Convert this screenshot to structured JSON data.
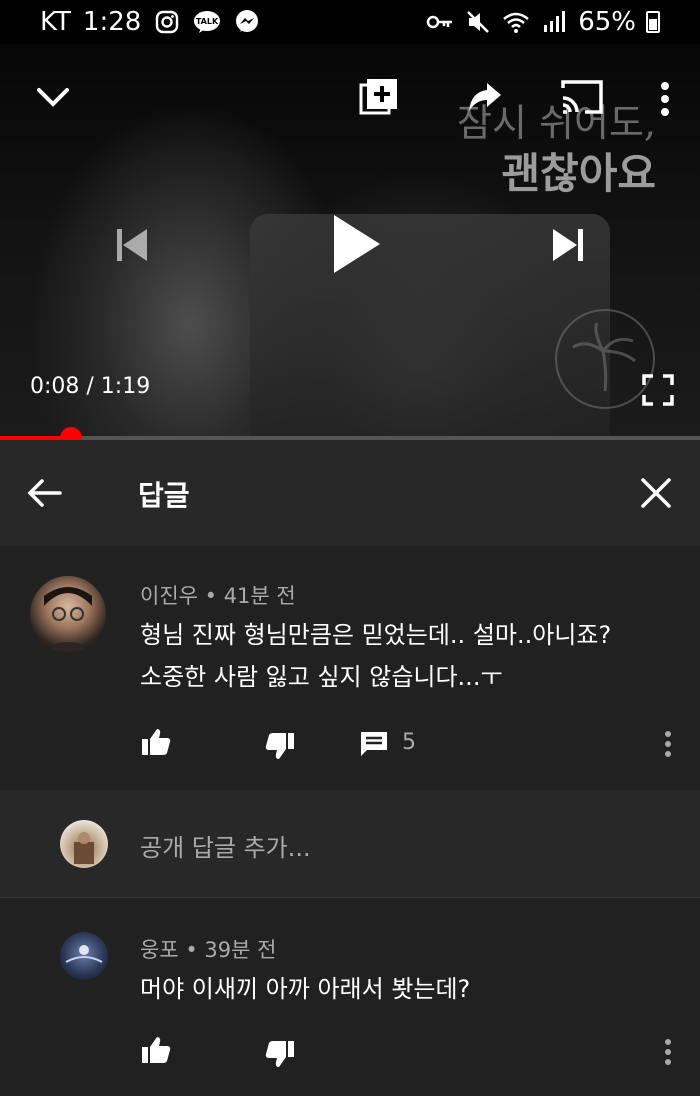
{
  "status_bar": {
    "carrier": "KT",
    "time": "1:28",
    "battery": "65%",
    "left_icons": [
      "instagram-icon",
      "kakaotalk-icon",
      "messenger-icon"
    ],
    "right_icons": [
      "key-icon",
      "mute-icon",
      "wifi-icon",
      "signal-icon",
      "battery-icon"
    ]
  },
  "video": {
    "overlay_line1": "잠시 쉬어도,",
    "overlay_line2": "괜찮아요",
    "current_time": "0:08",
    "duration": "1:19",
    "time_display": "0:08 / 1:19",
    "progress_fraction": 0.101,
    "state": "paused",
    "top_controls": [
      "collapse-icon",
      "add-to-playlist-icon",
      "share-icon",
      "cast-icon",
      "more-icon"
    ],
    "center_controls": [
      "previous-icon",
      "play-icon",
      "next-icon"
    ],
    "fullscreen_icon": "fullscreen-icon",
    "accent": "#ff0000"
  },
  "reply_panel": {
    "title": "답글"
  },
  "comments": [
    {
      "author": "이진우",
      "time": "41분 전",
      "meta": "이진우 • 41분 전",
      "line1": "형님 진짜 형님만큼은 믿었는데.. 설마..아니죠?",
      "line2": "소중한 사람 잃고 싶지 않습니다...ㅜ",
      "reply_count": "5"
    },
    {
      "author": "웅포",
      "time": "39분 전",
      "meta": "웅포 • 39분 전",
      "line1": "머야 이새끼 아까 아래서 봣는데?"
    }
  ],
  "add_reply": {
    "placeholder": "공개 답글 추가..."
  },
  "colors": {
    "background": "#212121",
    "header_background": "#282828",
    "secondary_text": "#aaaaaa"
  }
}
